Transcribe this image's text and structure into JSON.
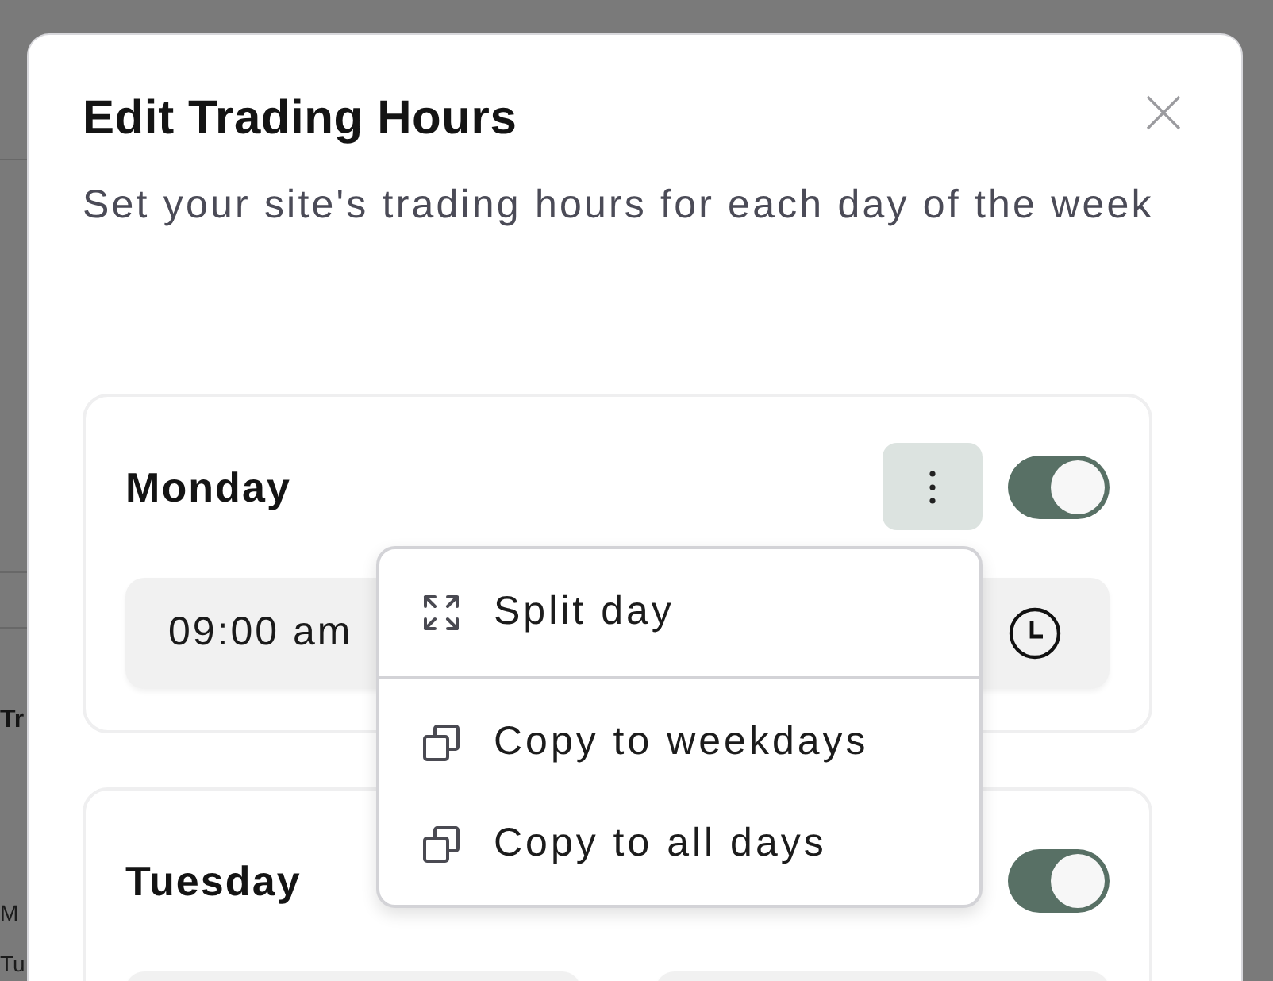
{
  "background": {
    "texts": [
      {
        "kind": "heading",
        "text": "Tr"
      },
      {
        "kind": "row",
        "text": "M"
      },
      {
        "kind": "row",
        "text": "Tu"
      }
    ]
  },
  "dialog": {
    "title": "Edit Trading Hours",
    "subtitle": "Set your site's trading hours for each day of the week"
  },
  "days": [
    {
      "name": "Monday",
      "on": true,
      "times": [
        {
          "value": "09:00 am",
          "clock": false
        },
        {
          "clock": true
        }
      ],
      "menu": {
        "sections": [
          [
            {
              "kind": "split",
              "label": "Split day"
            }
          ],
          [
            {
              "kind": "copy",
              "label": "Copy to weekdays"
            },
            {
              "kind": "copy",
              "label": "Copy to all days"
            }
          ]
        ]
      }
    },
    {
      "name": "Tuesday",
      "on": true,
      "times": [
        {
          "clock": false
        },
        {
          "clock": false
        }
      ]
    }
  ]
}
